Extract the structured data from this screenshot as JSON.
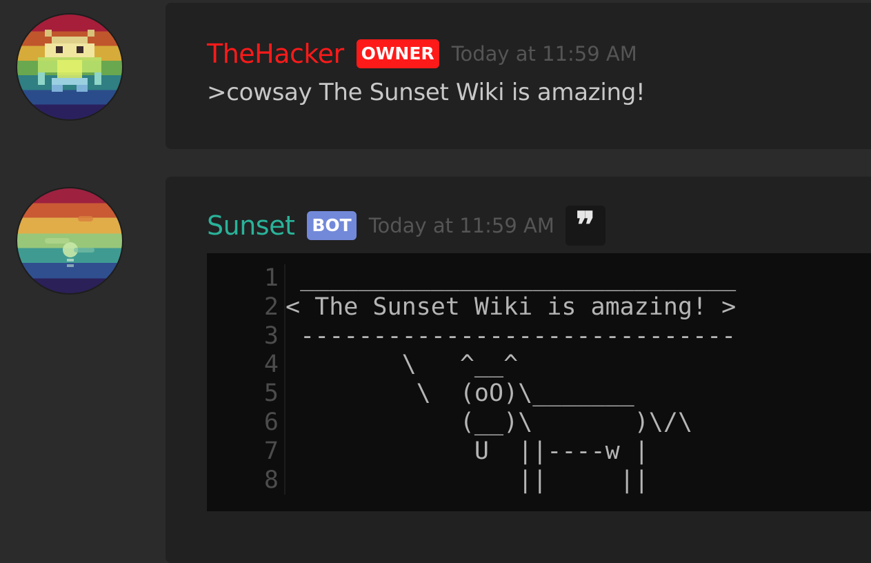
{
  "messages": [
    {
      "username": "TheHacker",
      "role_tag": "OWNER",
      "timestamp": "Today at 11:59 AM",
      "content": ">cowsay The Sunset Wiki is amazing!",
      "username_color": "#ff1a1a",
      "tag_color": "#ff1a1a"
    },
    {
      "username": "Sunset",
      "role_tag": "BOT",
      "timestamp": "Today at 11:59 AM",
      "quote_icon": "quote-icon",
      "quote_glyph": "❞",
      "username_color": "#2ab39a",
      "tag_color": "#7289da",
      "code_block": {
        "line_numbers": [
          "1",
          "2",
          "3",
          "4",
          "5",
          "6",
          "7",
          "8"
        ],
        "text": " ______________________________\n< The Sunset Wiki is amazing! >\n ------------------------------\n        \\   ^__^\n         \\  (oO)\\_______\n            (__)\\       )\\/\\\n             U  ||----w |\n                ||     ||"
      }
    }
  ],
  "colors": {
    "background": "#2b2b2b",
    "message_background": "#212121",
    "code_background": "#0d0d0d"
  }
}
